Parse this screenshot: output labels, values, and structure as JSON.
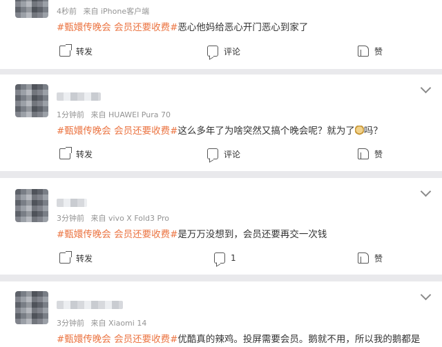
{
  "comments": [
    {
      "time": "4秒前",
      "source": "来自 iPhone客户端",
      "tag": "#甄嬛传晚会 会员还要收费#",
      "text": "恶心他妈给恶心开门恶心到家了",
      "actions": {
        "share": "转发",
        "comment": "评论",
        "like": "赞"
      }
    },
    {
      "time": "1分钟前",
      "source": "来自 HUAWEI Pura 70",
      "tag": "#甄嬛传晚会 会员还要收费#",
      "text_before": "这么多年了为啥突然又搞个晚会呢？就为了",
      "text_after": "吗？",
      "actions": {
        "share": "转发",
        "comment": "评论",
        "like": "赞"
      }
    },
    {
      "time": "3分钟前",
      "source": "来自 vivo X Fold3 Pro",
      "tag": "#甄嬛传晚会 会员还要收费#",
      "text": "是万万没想到，会员还要再交一次钱",
      "actions": {
        "share": "转发",
        "comment": "1",
        "like": "赞"
      }
    },
    {
      "time": "3分钟前",
      "source": "来自 Xiaomi 14",
      "tag": "#甄嬛传晚会 会员还要收费#",
      "text": "优酷真的辣鸡。投屏需要会员。鹅就不用，所以我的鹅都是"
    }
  ]
}
